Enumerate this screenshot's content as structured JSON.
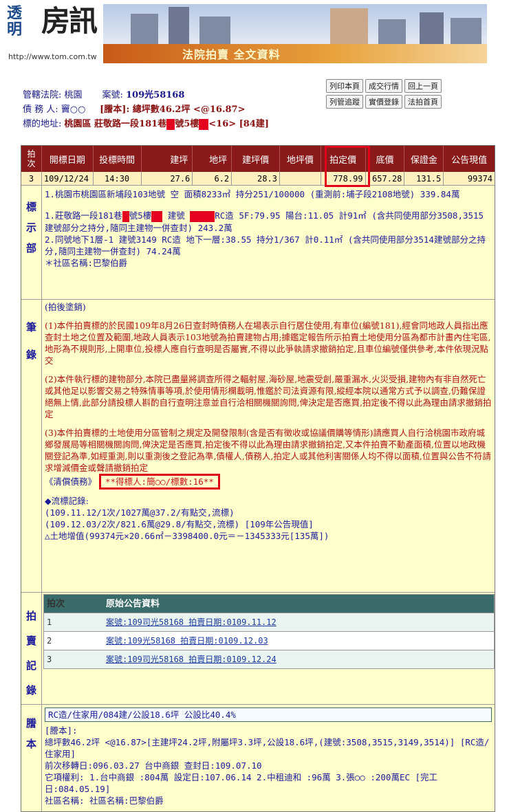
{
  "banner": {
    "logo_part1": "透明",
    "logo_part2": "房訊",
    "url": "http://www.tom.com.tw",
    "title": "法院拍賣  全文資料"
  },
  "case": {
    "court_label": "管轄法院:",
    "court": "桃園",
    "case_label": "案號:",
    "case_no": "109光58168",
    "debtor_label": "債 務 人:",
    "debtor": "竇○○",
    "ping_text": "[謄本]: 總坪數46.2坪 <@16.87>",
    "addr_label": "標的地址:",
    "addr_a": "桃園區 莊敬路一段181巷",
    "addr_b": "號5樓",
    "addr_c": "<16> [84建]"
  },
  "buttons": [
    [
      "列印本頁",
      "成交行情",
      "回上一頁"
    ],
    [
      "列管追蹤",
      "實價登錄",
      "法拍首頁"
    ]
  ],
  "table": {
    "headers": [
      "拍次",
      "開標日期",
      "投標時間",
      "建坪",
      "地坪",
      "建坪價",
      "地坪價",
      "拍定價",
      "底價",
      "保證金",
      "公告現值"
    ],
    "row": [
      "3",
      "109/12/24",
      "14:30",
      "27.6",
      "6.2",
      "28.3",
      "",
      "778.99",
      "657.28",
      "131.5",
      "99374"
    ]
  },
  "sections": {
    "label_side": [
      "標",
      "示",
      "部"
    ],
    "label_lines": [
      "1.桃園市桃園區新埔段103地號 空 面積8233㎡ 持分251/100000 (重測前:埔子段2108地號) 339.84萬",
      "1.莊敬路一段181巷",
      "號5樓",
      "建號",
      "RC造 5F:79.95 陽台:11.05 計91㎡ (含共同使用部分3508,3515建號部分之持分,隨同主建物一併查封) 243.2萬",
      "2.同號地下1層-1 建號3149 RC造 地下一層:38.55 持分1/367 計0.11㎡ (含共同使用部分3514建號部分之持分,隨同主建物一併查封) 74.24萬",
      "＊社區名稱:巴黎伯爵"
    ],
    "notes_side": [
      "筆",
      "錄"
    ],
    "notes_head": "(拍後塗銷)",
    "notes_1": "(1)本件拍賣標的於民國109年8月26日查封時債務人在場表示自行居住使用,有車位(編號181),經會同地政人員指出應查封土地之位置及範圍,地政人員表示103地號為拍賣建物占用;據鑑定報告所示拍賣土地使用分區為都市計畫內住宅區,地形為不規則形,上開車位,投標人應自行查明是否屬實,不得以此爭執請求撤銷拍定,且車位編號僅供參考,本件依現況點交",
    "notes_2": "(2)本件執行標的建物部分,本院已盡量將調查所得之輻射屋,海砂屋,地震受創,嚴重漏水,火災受損,建物內有非自然死亡或其他足以影響交易之特殊情事等項,於使用情形欄載明,惟鑑於司法資源有限,縱經本院以通常方式予以調查,仍難保證絕無上情,此部分請投標人斟酌自行查明注意並自行洽相關機關詢問,俾決定是否應買,拍定後不得以此為理由請求撤銷拍定",
    "notes_3": "(3)本件拍賣標的土地使用分區管制之規定及開發限制(含是否有徵收或協議價購等情形)請應買人自行洽桃園市政府城鄉發展局等相關機關詢問,俾決定是否應買,拍定後不得以此為理由請求撤銷拍定,又本件拍賣不動產面積,位置以地政機關登記為準,如經重測,則以重測後之登記為準,債權人,債務人,拍定人或其他利害關係人均不得以面積,位置與公告不符請求增減價金或聲請撤銷拍定",
    "notes_bond": "《清償債務》",
    "notes_winner": "**得標人:簡○○/標數:16**",
    "notes_flow_title": "◆流標記錄:",
    "notes_flow": [
      "(109.11.12/1次/1027萬@37.2/有點交,流標)",
      "(109.12.03/2次/821.6萬@29.8/有點交,流標) [109年公告現值]",
      "△土地增值(99374元×20.66㎡－3398400.0元＝－1345333元[135萬])"
    ],
    "records_side": [
      "拍",
      "賣",
      "記",
      "錄"
    ],
    "records_headers": [
      "拍次",
      "原始公告資料"
    ],
    "records": [
      {
        "n": "1",
        "text": "案號:109司光58168 拍賣日期:0109.11.12"
      },
      {
        "n": "2",
        "text": "案號:109光58168 拍賣日期:0109.12.03"
      },
      {
        "n": "3",
        "text": "案號:109司光58168 拍賣日期:0109.12.24"
      }
    ],
    "reg_side": [
      "謄",
      "本"
    ],
    "reg_line": "RC造/住家用/084建/公設18.6坪 公設比40.4%",
    "reg_lines": [
      "[謄本]:",
      "  總坪數46.2坪 <@16.87>[主建坪24.2坪,附屬坪3.3坪,公設18.6坪,(建號:3508,3515,3149,3514)] [RC造/住家用]",
      "前次移轉日:096.03.27  台中商銀 查封日:109.07.10",
      "它項權利: 1.台中商銀 :804萬 設定日:107.06.14 2.中租迪和 :96萬 3.張○○ :200萬EC [完工日:084.05.19]",
      "社區名稱: 社區名稱:巴黎伯爵"
    ]
  }
}
